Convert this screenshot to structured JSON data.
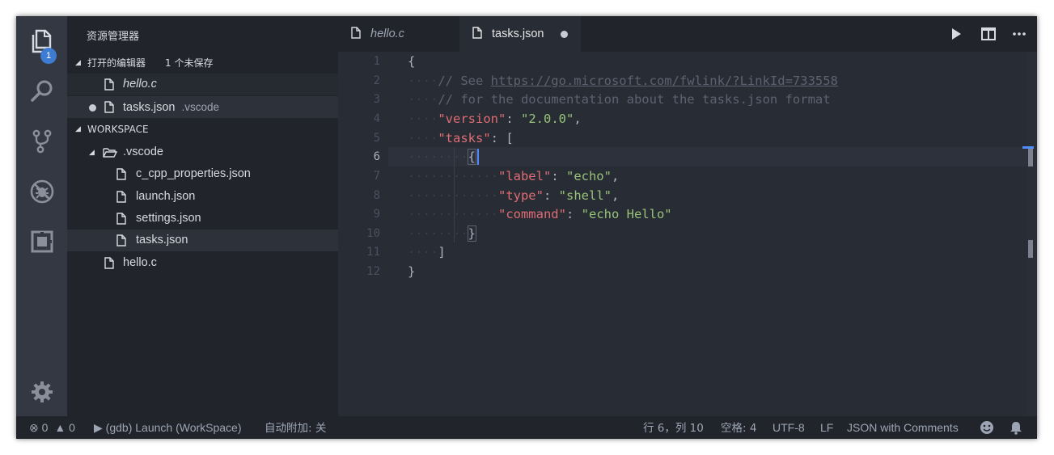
{
  "sidebar": {
    "title": "资源管理器",
    "open_editors": {
      "label": "打开的编辑器",
      "count_label": "1 个未保存",
      "items": [
        {
          "name": "hello.c",
          "sub": ""
        },
        {
          "name": "tasks.json",
          "sub": ".vscode"
        }
      ]
    },
    "workspace": {
      "label": "WORKSPACE",
      "folder": ".vscode",
      "files": [
        "c_cpp_properties.json",
        "launch.json",
        "settings.json",
        "tasks.json"
      ],
      "root_files": [
        "hello.c"
      ]
    }
  },
  "activity_bar": {
    "explorer_badge": "1",
    "icons": [
      "explorer-icon",
      "search-icon",
      "source-control-icon",
      "debug-icon",
      "extensions-icon",
      "settings-gear-icon"
    ]
  },
  "tabs": [
    {
      "label": "hello.c",
      "active": false,
      "dirty": false
    },
    {
      "label": "tasks.json",
      "active": true,
      "dirty": true
    }
  ],
  "editor": {
    "line_numbers": [
      "1",
      "2",
      "3",
      "4",
      "5",
      "6",
      "7",
      "8",
      "9",
      "10",
      "11",
      "12"
    ],
    "current_line": 6,
    "lines": {
      "l1": "{",
      "l2_comment": "// See ",
      "l2_link": "https://go.microsoft.com/fwlink/?LinkId=733558",
      "l3": "// for the documentation about the tasks.json format",
      "l4_key": "\"version\"",
      "l4_val": "\"2.0.0\"",
      "l5_key": "\"tasks\"",
      "l5_open": "[",
      "l6": "{",
      "l7_key": "\"label\"",
      "l7_val": "\"echo\"",
      "l8_key": "\"type\"",
      "l8_val": "\"shell\"",
      "l9_key": "\"command\"",
      "l9_val": "\"echo Hello\"",
      "l10": "}",
      "l11": "]",
      "l12": "}"
    }
  },
  "status_bar": {
    "errors": "0",
    "warnings": "0",
    "debug_config": "(gdb) Launch (WorkSpace)",
    "auto_attach": "自动附加: 关",
    "position": "行 6，列 10",
    "indent": "空格: 4",
    "encoding": "UTF-8",
    "eol": "LF",
    "language": "JSON with Comments"
  },
  "colors": {
    "accent": "#528bff",
    "badge": "#3e7bd3",
    "key": "#e06c75",
    "string": "#98c379",
    "comment": "#5c6370"
  }
}
